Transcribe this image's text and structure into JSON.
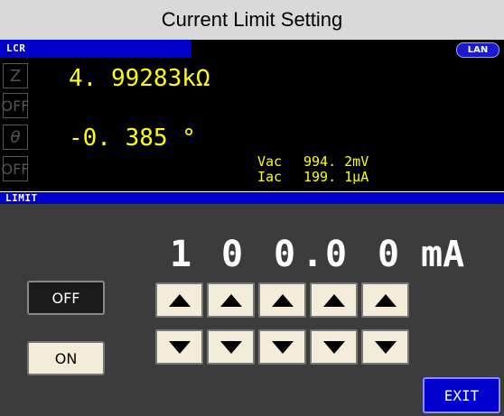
{
  "header": {
    "title": "Current Limit Setting"
  },
  "mode": {
    "label": "LCR",
    "interface": "LAN"
  },
  "params": [
    {
      "label": "Z"
    },
    {
      "label": "OFF"
    },
    {
      "label": "θ"
    },
    {
      "label": "OFF"
    }
  ],
  "measurements": {
    "primary": "4. 99283kΩ",
    "secondary": "-0. 385 °"
  },
  "monitor": {
    "vac_label": "Vac",
    "vac_value": "994. 2mV",
    "iac_label": "Iac",
    "iac_value": "199. 1μA"
  },
  "limit": {
    "section_label": "LIMIT",
    "digits": [
      "1",
      "0",
      "0",
      ".",
      "0",
      "0"
    ],
    "unit": "mA"
  },
  "buttons": {
    "off": "OFF",
    "on": "ON",
    "exit": "EXIT"
  },
  "icons": {
    "up": "triangle-up-icon",
    "down": "triangle-down-icon"
  },
  "colors": {
    "accent_blue": "#0000cc",
    "readout_yellow": "#ffff00",
    "panel_gray": "#3c3c3c",
    "button_beige": "#f2ecd9"
  }
}
